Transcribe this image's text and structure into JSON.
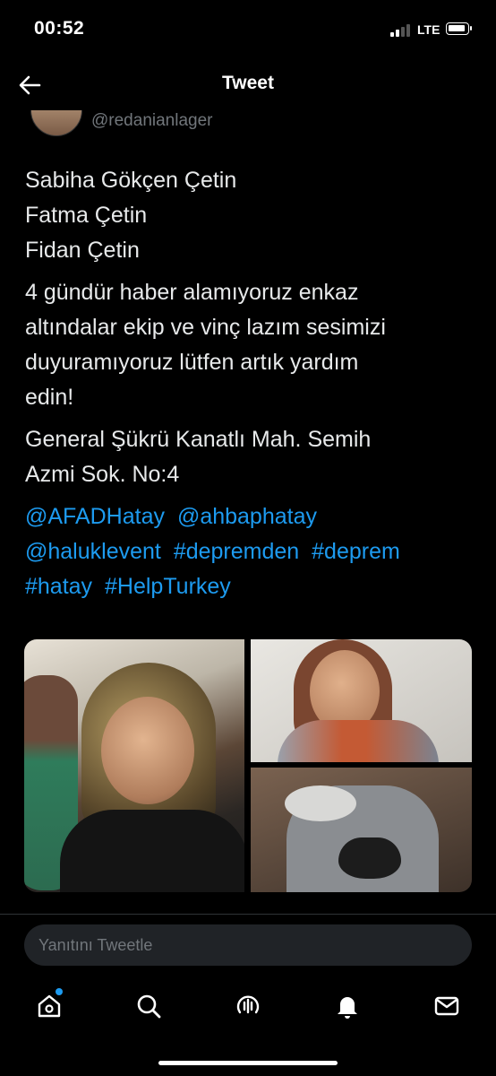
{
  "status": {
    "time": "00:52",
    "network": "LTE"
  },
  "header": {
    "title": "Tweet"
  },
  "author": {
    "handle": "@redanianlager"
  },
  "tweet": {
    "names": [
      "Sabiha Gökçen Çetin",
      "Fatma Çetin",
      "Fidan Çetin"
    ],
    "message": [
      "4 gündür haber alamıyoruz enkaz",
      "altındalar ekip ve vinç lazım sesimizi",
      "duyuramıyoruz lütfen artık yardım",
      "edin!"
    ],
    "address": [
      "General Şükrü Kanatlı Mah. Semih",
      "Azmi Sok. No:4"
    ],
    "links_line1": [
      "@AFADHatay",
      "@ahbaphatay"
    ],
    "links_line2": [
      "@haluklevent",
      "#depremden",
      "#deprem"
    ],
    "links_line3": [
      "#hatay",
      "#HelpTurkey"
    ]
  },
  "reply": {
    "placeholder": "Yanıtını Tweetle"
  },
  "tabs": [
    "home-icon",
    "search-icon",
    "spaces-icon",
    "notifications-icon",
    "messages-icon"
  ],
  "colors": {
    "link": "#1d9bf0",
    "background": "#000000",
    "text": "#e7e9ea",
    "muted": "#71767b"
  }
}
